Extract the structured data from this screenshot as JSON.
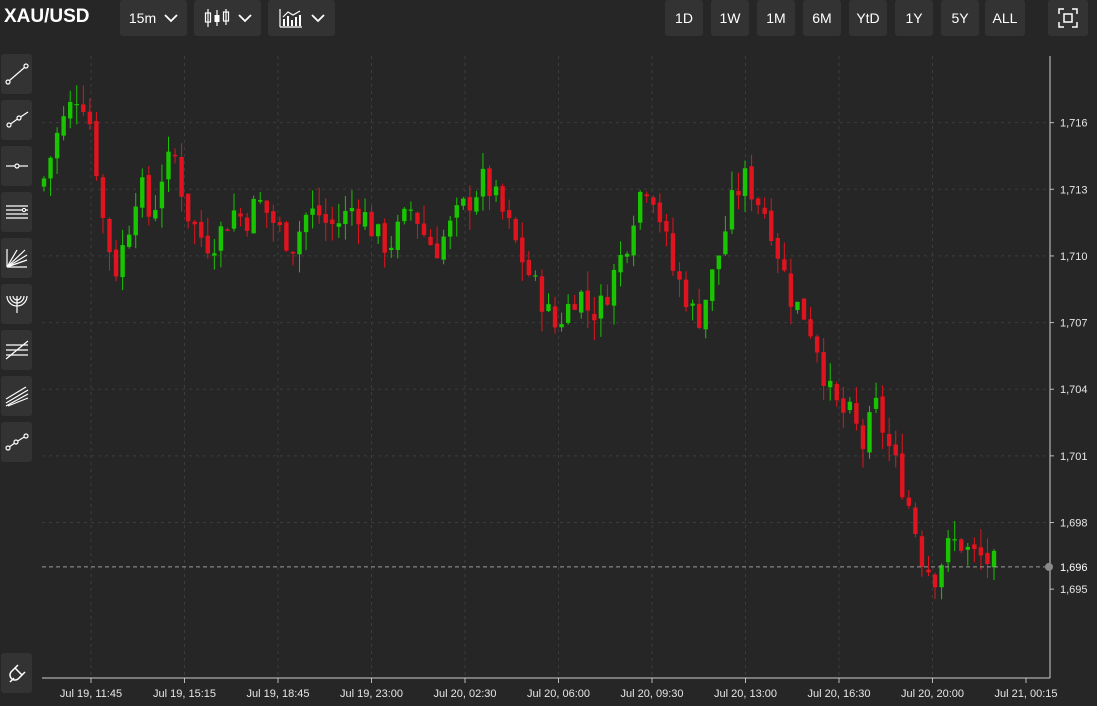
{
  "header": {
    "symbol": "XAU/USD",
    "interval": "15m",
    "chart_type_icon": "candlestick-icon",
    "indicators_icon": "indicators-icon",
    "ranges": [
      "1D",
      "1W",
      "1M",
      "6M",
      "YtD",
      "1Y",
      "5Y",
      "ALL"
    ],
    "fullscreen_icon": "fullscreen-icon"
  },
  "sidebar": {
    "tools": [
      "trend-line-icon",
      "ray-icon",
      "horizontal-line-icon",
      "parallel-channel-icon",
      "fib-fan-icon",
      "fib-arc-icon",
      "fib-retracement-icon",
      "pitchfork-icon",
      "path-icon"
    ],
    "magnet_icon": "magnet-icon"
  },
  "colors": {
    "up": "#19c400",
    "down": "#e0141e",
    "background": "#262626",
    "grid": "#3c3c3c"
  },
  "chart_data": {
    "type": "candlestick",
    "symbol": "XAU/USD",
    "interval": "15m",
    "y_ticks": [
      "1,716",
      "1,713",
      "1,710",
      "1,707",
      "1,704",
      "1,701",
      "1,698",
      "1,695"
    ],
    "x_ticks": [
      "Jul 19, 11:45",
      "Jul 19, 15:15",
      "Jul 19, 18:45",
      "Jul 19, 23:00",
      "Jul 20, 02:30",
      "Jul 20, 06:00",
      "Jul 20, 09:30",
      "Jul 20, 13:00",
      "Jul 20, 16:30",
      "Jul 20, 20:00",
      "Jul 21, 00:15"
    ],
    "last_price": "1,696",
    "ylim": [
      1691,
      1719
    ],
    "close_path": [
      1713.5,
      1715.3,
      1716.5,
      1717.5,
      1715.8,
      1711.5,
      1709.3,
      1711.0,
      1713.5,
      1711.5,
      1713.8,
      1714.5,
      1712.0,
      1711.0,
      1710.5,
      1711.2,
      1712.0,
      1711.6,
      1712.5,
      1711.8,
      1711.0,
      1710.5,
      1711.8,
      1712.0,
      1711.3,
      1711.6,
      1712.2,
      1711.8,
      1710.9,
      1710.4,
      1711.3,
      1712.2,
      1711.0,
      1710.3,
      1711.1,
      1712.0,
      1712.6,
      1713.4,
      1712.6,
      1711.5,
      1710.2,
      1709.0,
      1708.0,
      1706.8,
      1707.6,
      1708.5,
      1707.4,
      1707.8,
      1709.2,
      1710.5,
      1712.7,
      1713.4,
      1711.5,
      1709.3,
      1708.3,
      1707.0,
      1708.6,
      1710.4,
      1712.5,
      1713.5,
      1712.6,
      1711.8,
      1709.8,
      1708.0,
      1707.4,
      1706.2,
      1704.0,
      1703.0,
      1702.8,
      1701.4,
      1703.3,
      1701.6,
      1700.2,
      1698.5,
      1696.3,
      1695.6,
      1696.8,
      1697.2,
      1696.6,
      1696.4,
      1696.1
    ]
  }
}
